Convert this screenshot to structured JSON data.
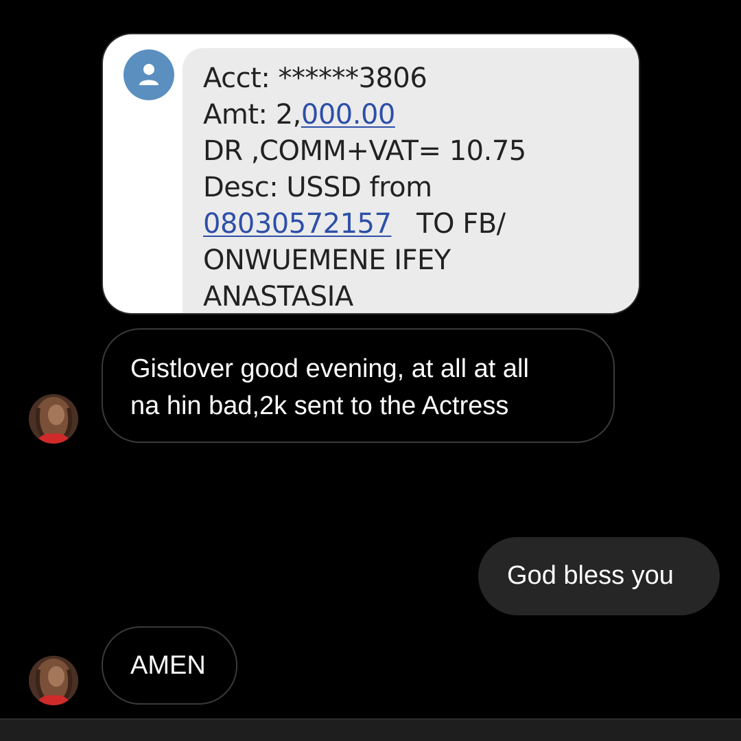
{
  "shared_image": {
    "sms_lines": {
      "acct": "Acct: ******3806",
      "amt_prefix": "Amt: 2,",
      "amt_link": "000.00",
      "dr": "DR ,COMM+VAT= 10.75",
      "desc": "Desc: USSD from",
      "phone_link": "08030572157",
      "to": "   TO FB/",
      "name_1": "ONWUEMENE IFEY",
      "name_2": "ANASTASIA"
    }
  },
  "messages": [
    {
      "direction": "received",
      "lines": [
        "Gistlover good evening, at all at all",
        "na hin bad,2k sent to the Actress"
      ]
    },
    {
      "direction": "sent",
      "text": "God bless you"
    },
    {
      "direction": "received",
      "text": "AMEN"
    }
  ],
  "colors": {
    "background": "#000000",
    "sent_bubble": "#262626",
    "received_border": "#3a3a3a",
    "link": "#2d4fa8",
    "sms_avatar": "#5a8fc0"
  },
  "icons": [
    "person-icon",
    "user-avatar"
  ]
}
